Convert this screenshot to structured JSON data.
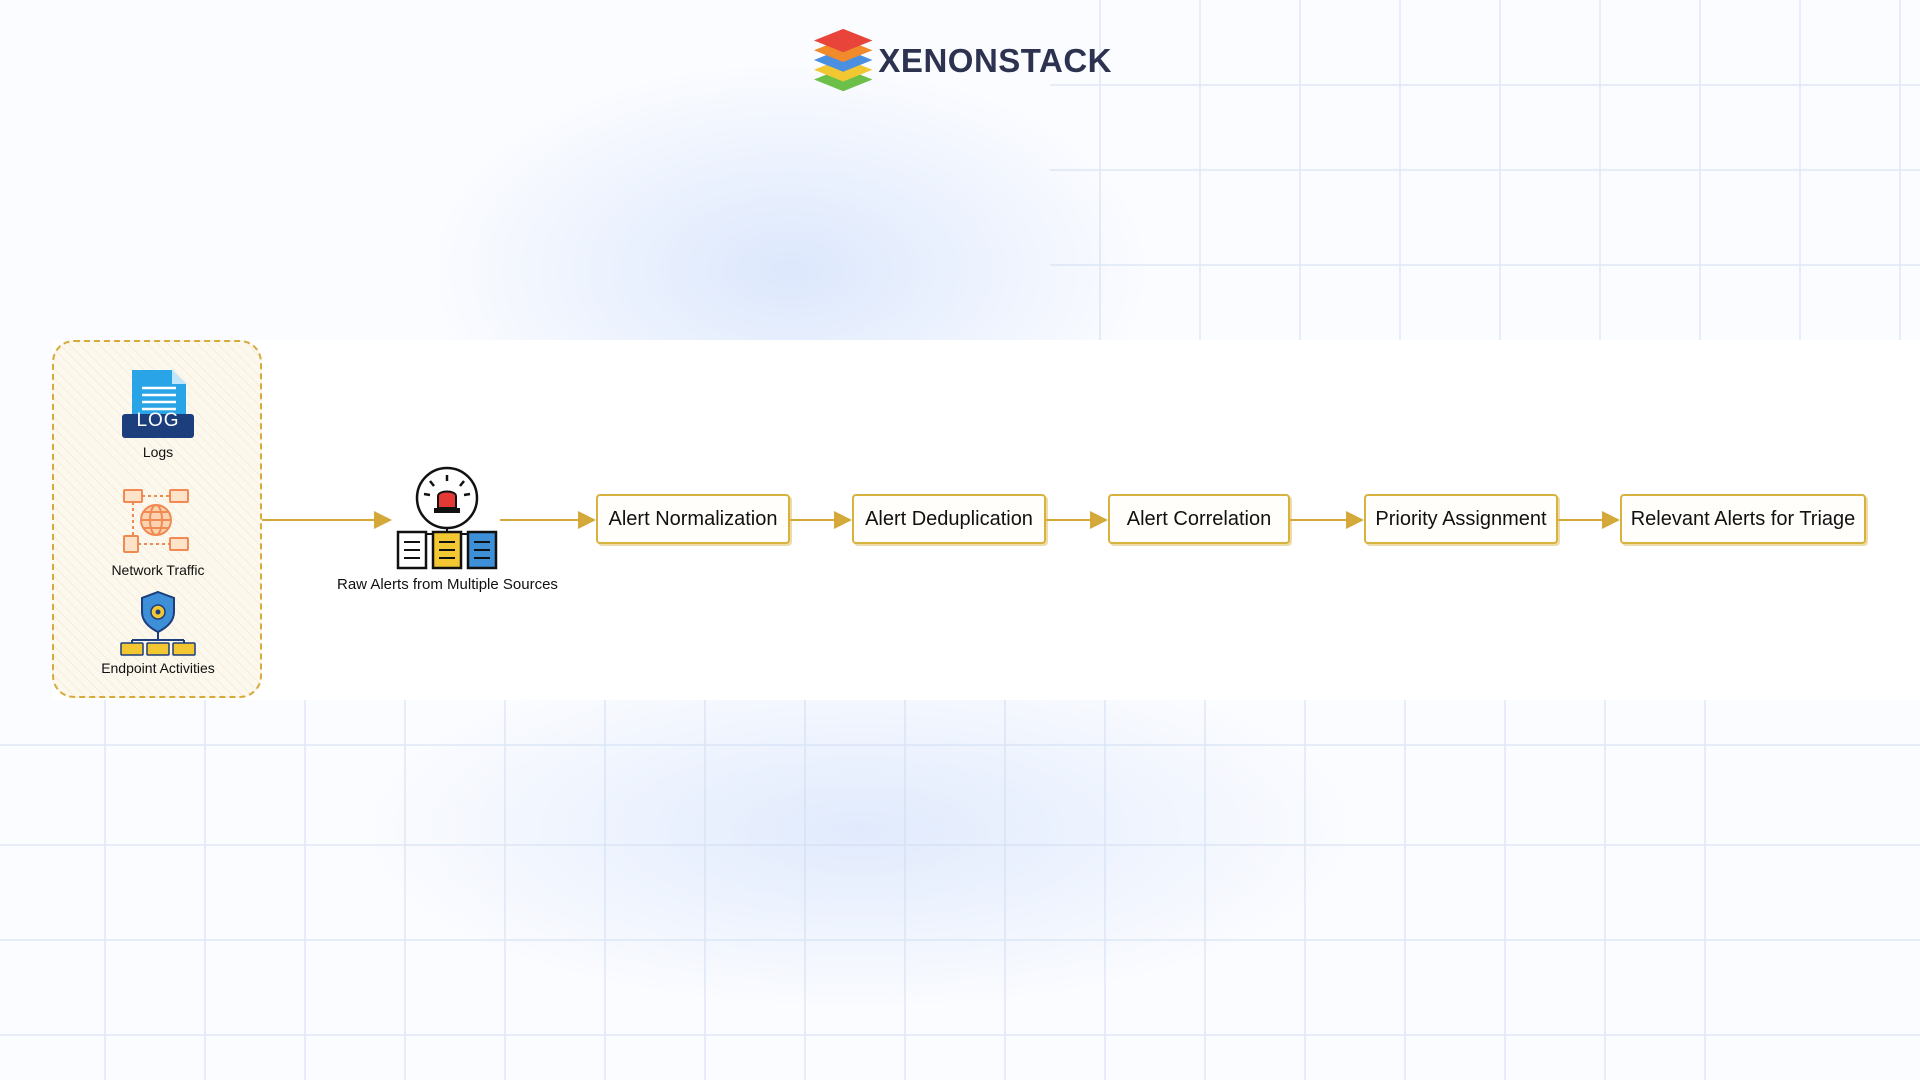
{
  "brand": {
    "name": "XENONSTACK",
    "layer_colors": [
      "#e8443a",
      "#f08a2b",
      "#4a8fe0",
      "#f3c732",
      "#6cc04a"
    ]
  },
  "sources": {
    "logs": {
      "label": "Logs",
      "badge": "LOG",
      "icon": "log-file-icon"
    },
    "network": {
      "label": "Network Traffic",
      "icon": "network-globe-icon"
    },
    "endpoint": {
      "label": "Endpoint Activities",
      "icon": "shield-network-icon"
    }
  },
  "raw_alerts": {
    "label": "Raw Alerts from Multiple Sources",
    "icon": "alarm-servers-icon"
  },
  "steps": [
    {
      "label": "Alert Normalization"
    },
    {
      "label": "Alert Deduplication"
    },
    {
      "label": "Alert Correlation"
    },
    {
      "label": "Priority Assignment"
    },
    {
      "label": "Relevant Alerts for Triage"
    }
  ],
  "colors": {
    "accent": "#d6aa3b",
    "arrow": "#d4a93a"
  }
}
